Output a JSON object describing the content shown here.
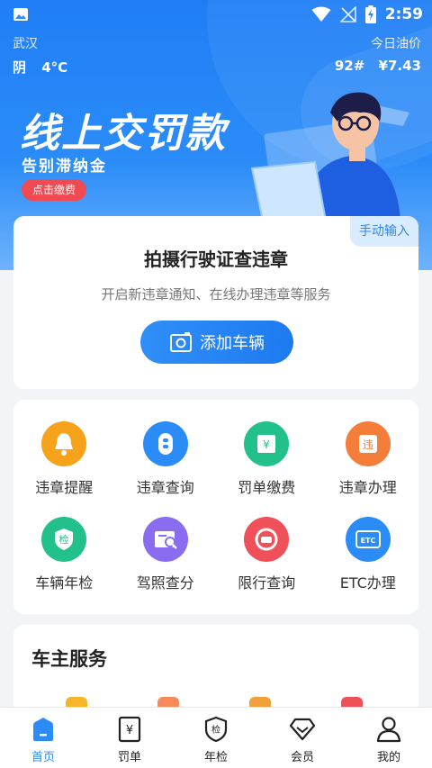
{
  "status_bar": {
    "time": "2:59"
  },
  "weather": {
    "city": "武汉",
    "condition": "阴",
    "temp": "4°C"
  },
  "oil": {
    "label": "今日油价",
    "grade": "92#",
    "price": "¥7.43"
  },
  "banner": {
    "title": "线上交罚款",
    "subtitle": "告别滞纳金",
    "button": "点击缴费"
  },
  "scan_card": {
    "manual_label": "手动输入",
    "title": "拍摄行驶证查违章",
    "subtitle": "开启新违章通知、在线办理违章等服务",
    "add_button": "添加车辆"
  },
  "services": [
    {
      "label": "违章提醒",
      "icon": "bell-icon",
      "color": "#f7a21b"
    },
    {
      "label": "违章查询",
      "icon": "query-icon",
      "color": "#2b8cf8"
    },
    {
      "label": "罚单缴费",
      "icon": "ticket-icon",
      "color": "#22c08a"
    },
    {
      "label": "违章办理",
      "icon": "handle-icon",
      "color": "#f57d3a"
    },
    {
      "label": "车辆年检",
      "icon": "inspection-icon",
      "color": "#22c08a"
    },
    {
      "label": "驾照查分",
      "icon": "license-icon",
      "color": "#8a6cf0"
    },
    {
      "label": "限行查询",
      "icon": "restriction-icon",
      "color": "#f0505a"
    },
    {
      "label": "ETC办理",
      "icon": "etc-icon",
      "color": "#2b8cf8"
    }
  ],
  "owner_service": {
    "title": "车主服务"
  },
  "bottom_nav": [
    {
      "label": "首页",
      "icon": "home-icon",
      "active": true
    },
    {
      "label": "罚单",
      "icon": "ticket-nav-icon",
      "active": false
    },
    {
      "label": "年检",
      "icon": "inspection-nav-icon",
      "active": false
    },
    {
      "label": "会员",
      "icon": "member-icon",
      "active": false
    },
    {
      "label": "我的",
      "icon": "profile-icon",
      "active": false
    }
  ]
}
